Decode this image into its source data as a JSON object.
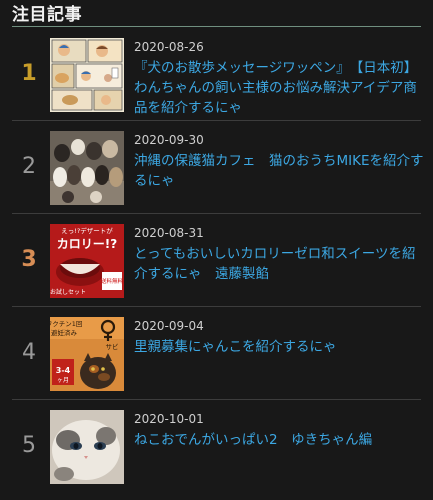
{
  "widget": {
    "title": "注目記事"
  },
  "articles": [
    {
      "rank": "1",
      "date": "2020-08-26",
      "title": "『犬のお散歩メッセージワッペン』　【日本初】わんちゃんの飼い主様のお悩み解決アイデア商品を紹介するにゃ",
      "thumbnail": {}
    },
    {
      "rank": "2",
      "date": "2020-09-30",
      "title": "沖縄の保護猫カフェ　猫のおうちMIKEを紹介するにゃ",
      "thumbnail": {}
    },
    {
      "rank": "3",
      "date": "2020-08-31",
      "title": "とってもおいしいカロリーゼロ和スイーツを紹介するにゃ　遠藤製餡",
      "thumbnail": {
        "text_top": "えっ!?デザートが",
        "text_main": "カロリー!?",
        "text_badge": "送料無料",
        "text_bottom": "お試しセット"
      }
    },
    {
      "rank": "4",
      "date": "2020-09-04",
      "title": "里親募集にゃんこを紹介するにゃ",
      "thumbnail": {
        "text_top": "ワクチン1回",
        "text_top2": "避妊済み",
        "text_badge": "サビ",
        "text_age": "3-4",
        "text_age_unit": "ヶ月"
      }
    },
    {
      "rank": "5",
      "date": "2020-10-01",
      "title": "ねこおでんがいっぱい2　ゆきちゃん編",
      "thumbnail": {}
    }
  ]
}
